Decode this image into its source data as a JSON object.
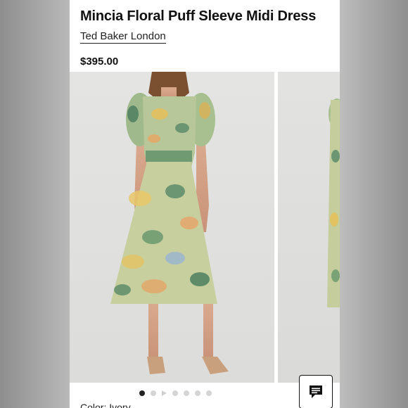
{
  "product": {
    "title": "Mincia Floral Puff Sleeve Midi Dress",
    "brand": "Ted Baker London",
    "price": "$395.00"
  },
  "gallery": {
    "dots": [
      "active",
      "inactive",
      "video",
      "inactive",
      "inactive",
      "inactive",
      "inactive"
    ]
  },
  "color": {
    "label": "Color: Ivory"
  },
  "chat": {
    "icon": "chat-bubble-icon"
  },
  "palette": {
    "background_blur": "#a9a9a9",
    "photo_bg": "#e2e2e0",
    "text": "#111111"
  }
}
